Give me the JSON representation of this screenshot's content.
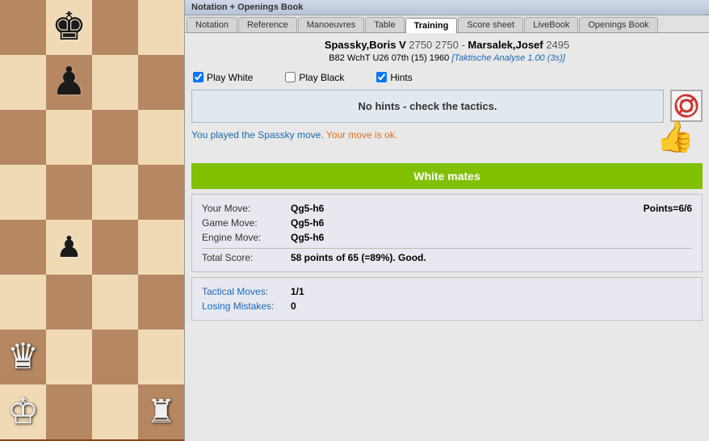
{
  "titleBar": {
    "text": "Notation + Openings Book"
  },
  "tabs": [
    {
      "label": "Notation",
      "active": false
    },
    {
      "label": "Reference",
      "active": false
    },
    {
      "label": "Manoeuvres",
      "active": false
    },
    {
      "label": "Table",
      "active": false
    },
    {
      "label": "Training",
      "active": true
    },
    {
      "label": "Score sheet",
      "active": false
    },
    {
      "label": "LiveBook",
      "active": false
    },
    {
      "label": "Openings Book",
      "active": false
    }
  ],
  "game": {
    "whiteName": "Spassky,Boris V",
    "whiteElo": "2750",
    "separator": " - ",
    "blackName": "Marsalek,Josef",
    "blackElo": "2495",
    "details": "B82  WchT U26 07th (15) 1960",
    "opening": "[Taktische Analyse 1.00 (3s)]"
  },
  "options": {
    "playWhite": {
      "label": "Play White",
      "checked": true
    },
    "playBlack": {
      "label": "Play Black",
      "checked": false
    },
    "hints": {
      "label": "Hints",
      "checked": true
    }
  },
  "hint": {
    "text": "No hints - check the tactics."
  },
  "feedback": {
    "part1": "You played the Spassky move.",
    "part2": " Your move is ok."
  },
  "matesBanner": {
    "text": "White mates"
  },
  "moves": {
    "yourMoveLabel": "Your Move:",
    "yourMoveValue": "Qg5-h6",
    "pointsLabel": "Points=6/6",
    "gameMoveLabel": "Game Move:",
    "gameMoveValue": "Qg5-h6",
    "engineMoveLabel": "Engine Move:",
    "engineMoveValue": "Qg5-h6",
    "totalScoreLabel": "Total Score:",
    "totalScoreValue": "58 points of 65 (=89%). Good."
  },
  "stats": {
    "tacticalMovesLabel": "Tactical Moves:",
    "tacticalMovesValue": "1/1",
    "losingMistakesLabel": "Losing Mistakes:",
    "losingMistakesValue": "0"
  },
  "colors": {
    "green": "#80c000",
    "blue": "#1a6ab5",
    "orange": "#e07020"
  },
  "board": {
    "description": "Partial chess board view showing left 4 columns"
  }
}
